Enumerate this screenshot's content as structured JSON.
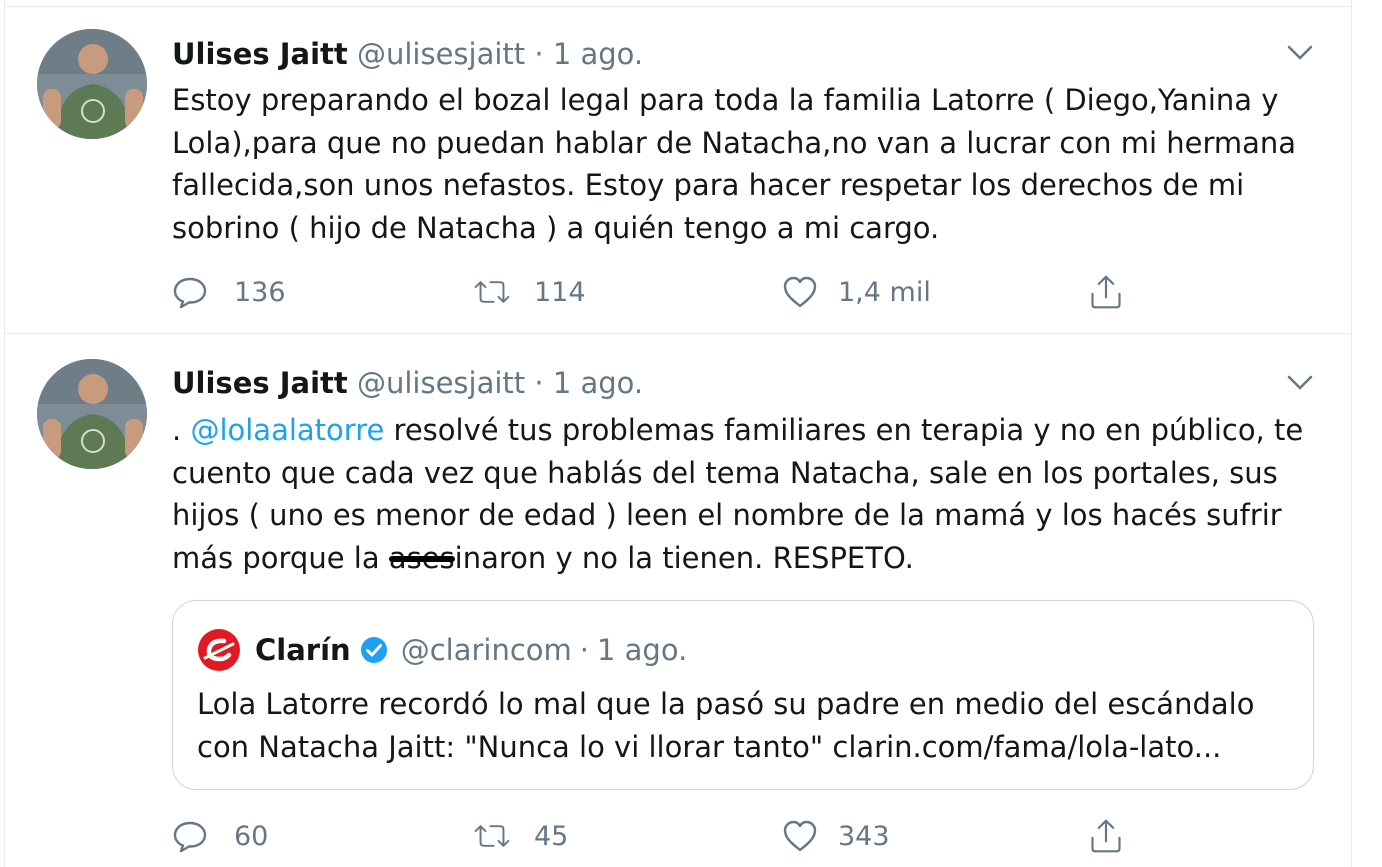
{
  "tweets": [
    {
      "author_name": "Ulises Jaitt",
      "author_handle": "@ulisesjaitt",
      "separator": "·",
      "time": "1 ago.",
      "text": "Estoy preparando el bozal legal para toda la familia Latorre ( Diego,Yanina y Lola),para que no puedan hablar de Natacha,no van a lucrar con mi hermana fallecida,son unos nefastos. Estoy para hacer respetar los derechos de mi sobrino ( hijo de Natacha ) a quién tengo a mi cargo.",
      "reply_count": "136",
      "retweet_count": "114",
      "like_count": "1,4 mil"
    },
    {
      "author_name": "Ulises Jaitt",
      "author_handle": "@ulisesjaitt",
      "separator": "·",
      "time": "1 ago.",
      "text_prefix": ". ",
      "mention": "@lolaalatorre",
      "text_part1": " resolvé tus problemas familiares en terapia y no en público, te cuento que cada vez que hablás del tema Natacha, sale en los portales, sus hijos ( uno es menor de edad ) leen el nombre de la mamá y los hacés sufrir más porque la ",
      "text_redacted": "ases",
      "text_part2": "inaron y no la tienen. RESPETO.",
      "quote": {
        "author_name": "Clarín",
        "author_handle": "@clarincom",
        "separator": "·",
        "time": "1 ago.",
        "text": "Lola Latorre recordó lo mal que la pasó su padre en medio del escándalo con Natacha Jaitt: \"Nunca lo vi llorar tanto\" clarin.com/fama/lola-lato..."
      },
      "reply_count": "60",
      "retweet_count": "45",
      "like_count": "343"
    }
  ],
  "colors": {
    "text": "#14171a",
    "secondary": "#657786",
    "link": "#1da1f2",
    "border": "#e6ecf0",
    "clarin_red": "#e01a22"
  },
  "icons": [
    "chevron-down-icon",
    "reply-icon",
    "retweet-icon",
    "like-icon",
    "share-icon",
    "verified-icon",
    "clarin-logo"
  ]
}
